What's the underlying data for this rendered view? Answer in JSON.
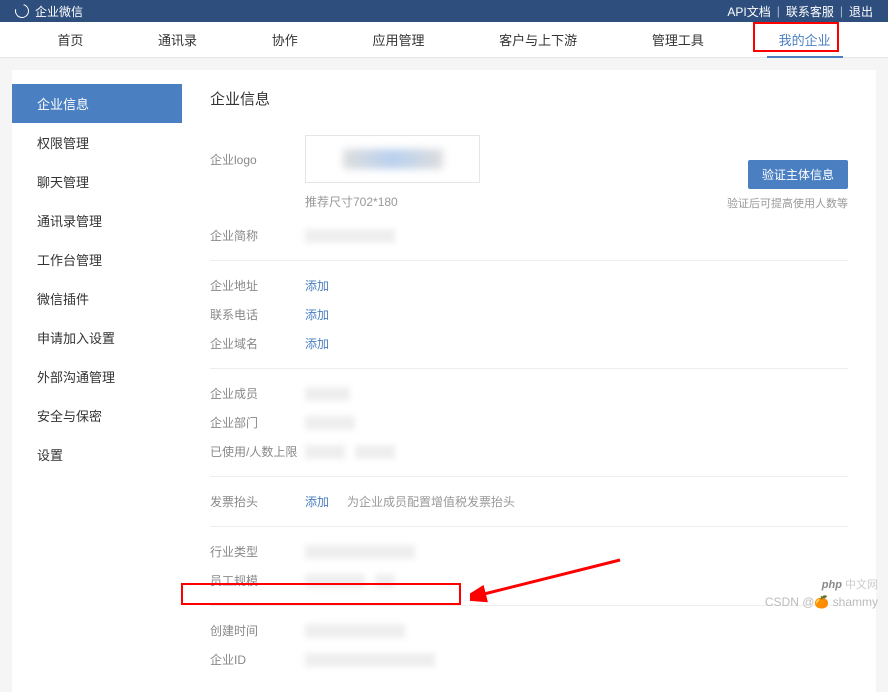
{
  "header": {
    "app_name": "企业微信",
    "links": {
      "api": "API文档",
      "support": "联系客服",
      "logout": "退出"
    }
  },
  "nav": {
    "items": [
      "首页",
      "通讯录",
      "协作",
      "应用管理",
      "客户与上下游",
      "管理工具",
      "我的企业"
    ],
    "active_index": 6
  },
  "sidebar": {
    "items": [
      "企业信息",
      "权限管理",
      "聊天管理",
      "通讯录管理",
      "工作台管理",
      "微信插件",
      "申请加入设置",
      "外部沟通管理",
      "安全与保密",
      "设置"
    ],
    "active_index": 0
  },
  "main": {
    "title": "企业信息",
    "logo_label": "企业logo",
    "logo_hint": "推荐尺寸702*180",
    "verify_btn": "验证主体信息",
    "verify_hint": "验证后可提高使用人数等",
    "short_name_label": "企业简称",
    "address_label": "企业地址",
    "phone_label": "联系电话",
    "domain_label": "企业域名",
    "add_link": "添加",
    "members_label": "企业成员",
    "depts_label": "企业部门",
    "usage_label": "已使用/人数上限",
    "invoice_label": "发票抬头",
    "invoice_desc": "为企业成员配置增值税发票抬头",
    "industry_label": "行业类型",
    "scale_label": "员工规模",
    "create_label": "创建时间",
    "id_label": "企业ID"
  },
  "watermark": {
    "phpcn": "php 中文网",
    "csdn": "CSDN @🍊 shammy"
  }
}
